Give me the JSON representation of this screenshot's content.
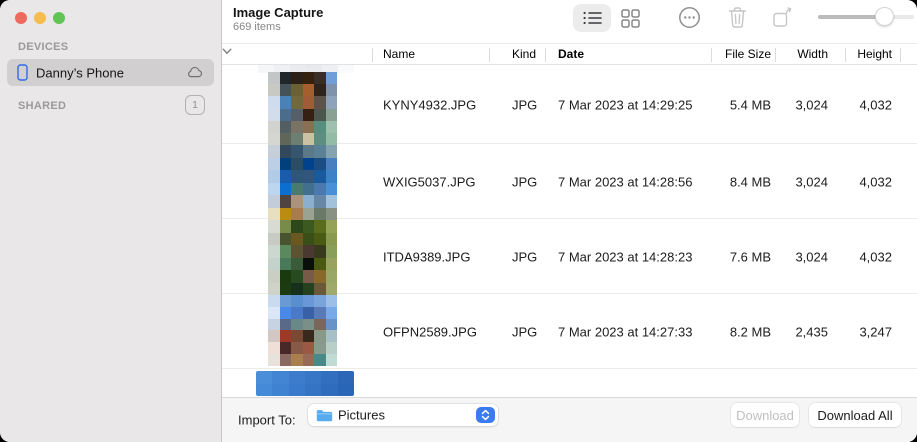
{
  "window": {
    "title": "Image Capture",
    "subtitle": "669 items"
  },
  "sidebar": {
    "devices_label": "DEVICES",
    "device": {
      "name": "Danny’s Phone",
      "icon": "iphone-icon",
      "status_icon": "cloud-icon"
    },
    "shared_label": "SHARED",
    "shared_badge": "1"
  },
  "toolbar": {
    "icons": [
      "list-view-icon",
      "grid-view-icon",
      "more-icon",
      "trash-icon",
      "rotate-icon"
    ],
    "active_view": "list",
    "zoom_slider_value": 0.72
  },
  "table": {
    "columns": [
      {
        "label": "Name"
      },
      {
        "label": "Kind"
      },
      {
        "label": "Date",
        "sorted": true,
        "sort_icon": "chevron-down-icon"
      },
      {
        "label": "File Size"
      },
      {
        "label": "Width"
      },
      {
        "label": "Height"
      }
    ],
    "rows": [
      {
        "name": "KYNY4932.JPG",
        "kind": "JPG",
        "date": "7 Mar 2023 at 14:29:25",
        "file_size": "5.4 MB",
        "width": "3,024",
        "height": "4,032"
      },
      {
        "name": "WXIG5037.JPG",
        "kind": "JPG",
        "date": "7 Mar 2023 at 14:28:56",
        "file_size": "8.4 MB",
        "width": "3,024",
        "height": "4,032"
      },
      {
        "name": "ITDA9389.JPG",
        "kind": "JPG",
        "date": "7 Mar 2023 at 14:28:23",
        "file_size": "7.6 MB",
        "width": "3,024",
        "height": "4,032"
      },
      {
        "name": "OFPN2589.JPG",
        "kind": "JPG",
        "date": "7 Mar 2023 at 14:27:33",
        "file_size": "8.2 MB",
        "width": "2,435",
        "height": "3,247"
      }
    ]
  },
  "footer": {
    "import_label": "Import To:",
    "import_value": "Pictures",
    "import_icon": "folder-icon",
    "download_label": "Download",
    "download_enabled": false,
    "download_all_label": "Download All"
  },
  "colors": {
    "sidebar_bg": "#e9e7e8",
    "sidebar_selected": "#d2cfd0",
    "accent_blue": "#3b7bf0",
    "traffic_red": "#ee6a5f",
    "traffic_yellow": "#f5bd4f",
    "traffic_green": "#61c454",
    "footer_bg": "#f6f5f5"
  },
  "thumbnails": {
    "top_partial": [
      [
        "#f4f6f7",
        "#eef0f3",
        "#e9ebef",
        "#e7e9ed",
        "#edeff3",
        "#f9fafb"
      ]
    ],
    "photo_1": [
      [
        "#c2c6c7",
        "#20262a",
        "#2b2119",
        "#33210e",
        "#392d28",
        "#6f9fd6"
      ],
      [
        "#c9c9c4",
        "#45525a",
        "#6b6134",
        "#a55e2d",
        "#2d231f",
        "#7e93ab"
      ],
      [
        "#cedcee",
        "#4a82b6",
        "#74673c",
        "#a15b36",
        "#5b544b",
        "#8ca3bb"
      ],
      [
        "#d3dcea",
        "#4a6d8c",
        "#555e69",
        "#361f13",
        "#4b574e",
        "#8aa092"
      ],
      [
        "#d2d3cf",
        "#525e62",
        "#797366",
        "#897053",
        "#568f80",
        "#9cc1ad"
      ],
      [
        "#d5d6d2",
        "#606659",
        "#6c7f71",
        "#cbc2a3",
        "#5c8f7f",
        "#92bca5"
      ]
    ],
    "photo_2": [
      [
        "#c5ced9",
        "#32485b",
        "#35566e",
        "#5c798a",
        "#5b8294",
        "#85a2b1"
      ],
      [
        "#bccfe5",
        "#02407d",
        "#2b4c65",
        "#02418b",
        "#1b4d82",
        "#497ebf"
      ],
      [
        "#b2cce7",
        "#195cad",
        "#2d5677",
        "#32567b",
        "#195a9d",
        "#3c82c7"
      ],
      [
        "#bdd6ef",
        "#0b6ed1",
        "#4c796f",
        "#41708e",
        "#4979af",
        "#4990d7"
      ],
      [
        "#c3cdda",
        "#504440",
        "#aa9378",
        "#8bafcf",
        "#6787a7",
        "#a2c1db"
      ],
      [
        "#e7dfbf",
        "#ba8c11",
        "#a77d4d",
        "#9aa292",
        "#697a69",
        "#899282"
      ]
    ],
    "photo_3": [
      [
        "#d8dbd2",
        "#798b49",
        "#2d491a",
        "#3c591f",
        "#596d1d",
        "#95a359"
      ],
      [
        "#c7cbc3",
        "#49542f",
        "#695920",
        "#394f17",
        "#495b13",
        "#89994f"
      ],
      [
        "#cbd7cf",
        "#59895d",
        "#5b5331",
        "#493931",
        "#39391d",
        "#899f59"
      ],
      [
        "#c3d3cb",
        "#497959",
        "#395b39",
        "#0a0f0a",
        "#495910",
        "#97a35f"
      ],
      [
        "#cbcfc3",
        "#19390f",
        "#294921",
        "#795947",
        "#896929",
        "#99a767"
      ],
      [
        "#cfd3c7",
        "#1d3b13",
        "#15311b",
        "#25411d",
        "#695939",
        "#9fa969"
      ]
    ],
    "photo_4": [
      [
        "#cbdbef",
        "#699ad3",
        "#5a8fcf",
        "#6997d7",
        "#79a3db",
        "#9bbfe7"
      ],
      [
        "#dbe7f7",
        "#4989e7",
        "#4979c7",
        "#3961a7",
        "#5979b7",
        "#79a9e7"
      ],
      [
        "#c7d3e3",
        "#596987",
        "#698989",
        "#798f87",
        "#796757",
        "#6993c7"
      ],
      [
        "#d3c7c3",
        "#9f3927",
        "#794933",
        "#39291d",
        "#899989",
        "#a7bfc7"
      ],
      [
        "#efdfd7",
        "#492927",
        "#895947",
        "#995943",
        "#89998b",
        "#b7cfc7"
      ],
      [
        "#e7e3db",
        "#896961",
        "#aa7f4f",
        "#996957",
        "#498989",
        "#bfdbd3"
      ]
    ],
    "bottom_partial": [
      [
        "#4a8ed9",
        "#4385d3",
        "#3d7ccc",
        "#3876c6",
        "#3270bf",
        "#2b67b6"
      ],
      [
        "#458ad9",
        "#3f82d2",
        "#3a7acc",
        "#3573c5",
        "#2f6cbe",
        "#2a66b7"
      ]
    ]
  }
}
